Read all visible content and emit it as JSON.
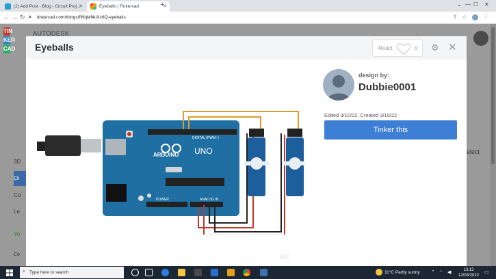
{
  "browser": {
    "tabs": [
      {
        "title": "(2) Add Post - Blog - Circuit Proj...",
        "active": false
      },
      {
        "title": "Eyeballs | Tinkercad",
        "active": true
      }
    ],
    "url": "tinkercad.com/things/fWqMf4uXz8Q-eyeballs"
  },
  "background": {
    "logo_letters": [
      "TIN",
      "KER",
      "CAD"
    ],
    "brand": "AUTODESK",
    "sidebar_items": [
      "3D",
      "Cli",
      "Co",
      "Le",
      "Yo",
      "Co"
    ],
    "select_text": "elect"
  },
  "modal": {
    "title": "Eyeballs",
    "react_label": "React",
    "react_count": "0",
    "design_by_label": "design by:",
    "author": "Dubbie0001",
    "meta": "Edited 3/10/22, Created 3/10/22",
    "tinker_button": "Tinker this",
    "board_labels": {
      "brand": "ARDUINO",
      "model": "UNO",
      "digital": "DIGITAL (PWM~)",
      "power": "POWER",
      "analog": "ANALOG IN"
    }
  },
  "taskbar": {
    "search_placeholder": "Type here to search",
    "weather": "11°C  Partly sunny",
    "time": "13:13",
    "date": "12/03/2022"
  },
  "colors": {
    "accent": "#3e7fd6",
    "board": "#1f6fa3",
    "wire_orange": "#e09a2f",
    "wire_red": "#c0392b",
    "servo": "#1d5e9c"
  }
}
